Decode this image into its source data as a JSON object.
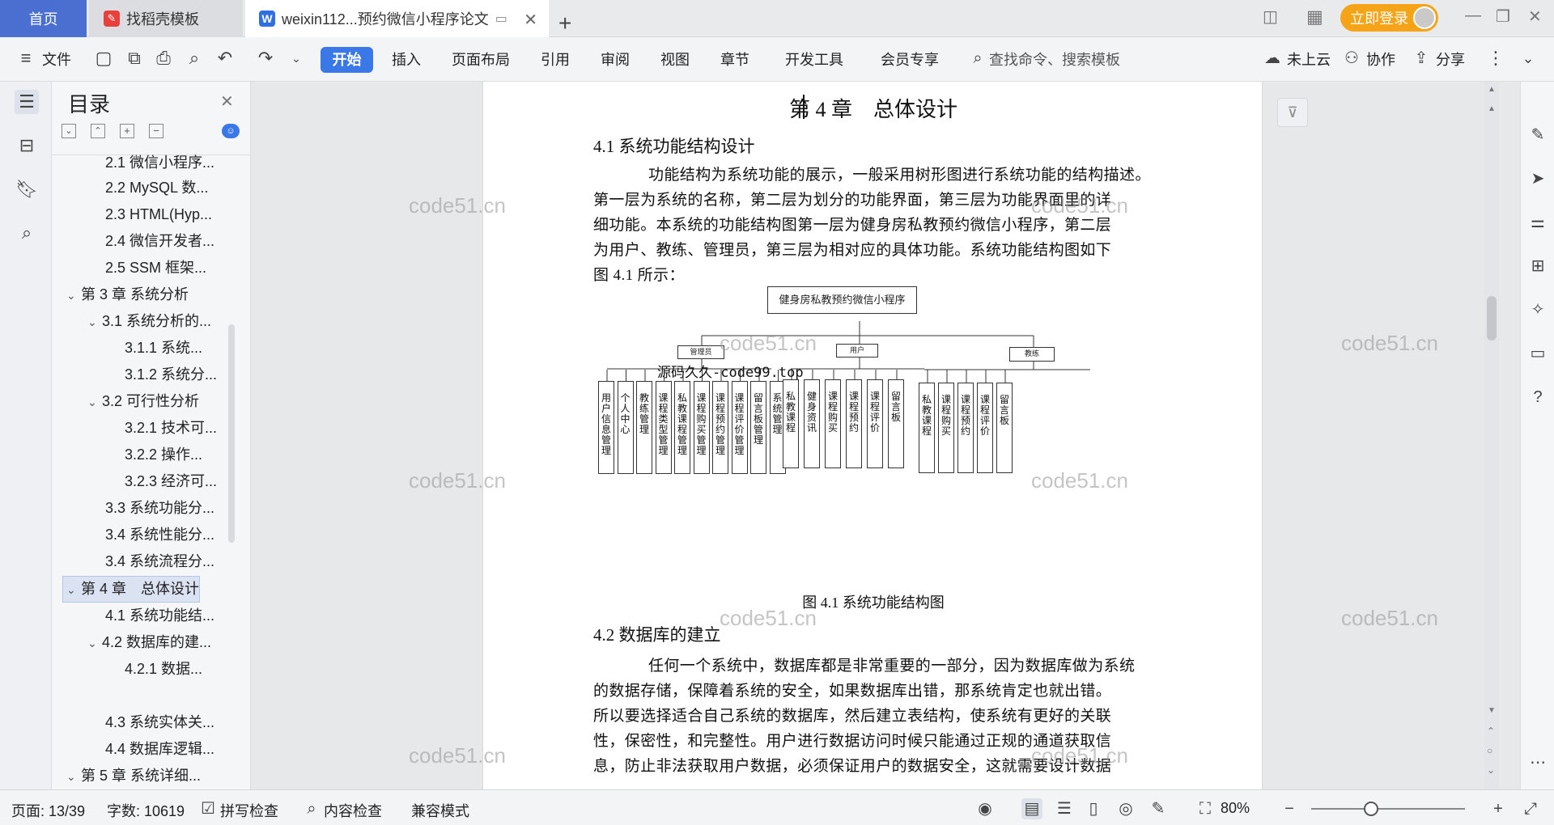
{
  "tabs": {
    "home": "首页",
    "template": "找稻壳模板",
    "doc": "weixin112...预约微信小程序论文",
    "add": "+"
  },
  "header": {
    "login": "立即登录"
  },
  "toolbar": {
    "file": "文件",
    "menus": [
      "开始",
      "插入",
      "页面布局",
      "引用",
      "审阅",
      "视图",
      "章节",
      "开发工具",
      "会员专享"
    ],
    "search": "查找命令、搜索模板",
    "cloud": "未上云",
    "collab": "协作",
    "share": "分享"
  },
  "toc": {
    "title": "目录",
    "items": [
      "2.1 微信小程序...",
      "2.2 MySQL 数...",
      "2.3 HTML(Hyp...",
      "2.4 微信开发者...",
      "2.5 SSM 框架...",
      "第 3 章 系统分析",
      "3.1 系统分析的...",
      "3.1.1 系统...",
      "3.1.2 系统分...",
      "3.2 可行性分析",
      "3.2.1 技术可...",
      "3.2.2 操作...",
      "3.2.3 经济可...",
      "3.3 系统功能分...",
      "3.4 系统性能分...",
      "3.4 系统流程分...",
      "第 4 章　总体设计",
      "4.1 系统功能结...",
      "4.2 数据库的建...",
      "4.2.1 数据...",
      "4.3 系统实体关...",
      "4.4 数据库逻辑...",
      "第 5 章 系统详细..."
    ]
  },
  "doc": {
    "chapter": "第 4 章　总体设计",
    "sec41": "4.1  系统功能结构设计",
    "para1": [
      "功能结构为系统功能的展示，一般采用树形图进行系统功能的结构描述。",
      "第一层为系统的名称，第二层为划分的功能界面，第三层为功能界面里的详",
      "细功能。本系统的功能结构图第一层为健身房私教预约微信小程序，第二层",
      "为用户、教练、管理员，第三层为相对应的具体功能。系统功能结构图如下",
      "图 4.1 所示："
    ],
    "chart_root": "健身房私教预约微信小程序",
    "chart_groups": [
      "管理员",
      "用户",
      "教练"
    ],
    "admin_items": [
      "用户信息管理",
      "个人中心",
      "教练管理",
      "课程类型管理",
      "私教课程管理",
      "课程购买管理",
      "课程预约管理",
      "课程评价管理",
      "留言板管理",
      "系统管理"
    ],
    "user_items": [
      "私教课程",
      "健身资讯",
      "课程购买",
      "课程预约",
      "课程评价",
      "留言板"
    ],
    "coach_items": [
      "私教课程",
      "课程购买",
      "课程预约",
      "课程评价",
      "留言板"
    ],
    "overlay_text": "源码久久-code99.top",
    "caption": "图 4.1 系统功能结构图",
    "sec42": "4.2  数据库的建立",
    "para2": [
      "任何一个系统中，数据库都是非常重要的一部分，因为数据库做为系统",
      "的数据存储，保障着系统的安全，如果数据库出错，那系统肯定也就出错。",
      "所以要选择适合自己系统的数据库，然后建立表结构，使系统有更好的关联",
      "性，保密性，和完整性。用户进行数据访问时候只能通过正规的通道获取信",
      "息，防止非法获取用户数据，必须保证用户的数据安全，这就需要设计数据"
    ],
    "watermark": "code51.cn"
  },
  "status": {
    "page": "页面: 13/39",
    "words": "字数: 10619",
    "spell": "拼写检查",
    "content": "内容检查",
    "compat": "兼容模式",
    "zoom": "80%",
    "zoom_level": 0.8
  }
}
